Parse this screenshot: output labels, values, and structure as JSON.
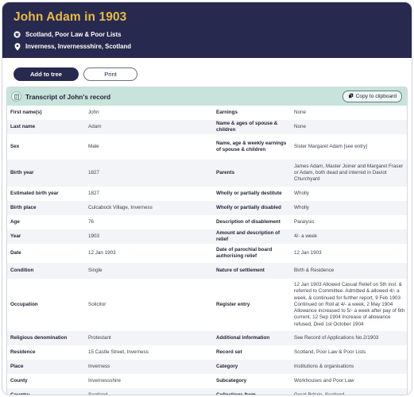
{
  "header": {
    "title": "John Adam in 1903",
    "collection": "Scotland, Poor Law & Poor Lists",
    "location": "Inverness, Invernessshire, Scotland",
    "collection_icon": "archive-icon",
    "location_icon": "location-pin-icon",
    "bg_color": "#27294e",
    "title_color": "#e9b949"
  },
  "actions": {
    "add_label": "Add to tree",
    "print_label": "Print"
  },
  "record": {
    "title": "Transcript of John's record",
    "copy_label": "Copy to clipboard",
    "head_color": "#c7e3dc",
    "rows": [
      {
        "l1": "First name(s)",
        "v1": "John",
        "l2": "Earnings",
        "v2": "None"
      },
      {
        "l1": "Last name",
        "v1": "Adam",
        "l2": "Name & ages of spouse & children",
        "v2": "None"
      },
      {
        "l1": "Sex",
        "v1": "Male",
        "l2": "Name, age & weekly earnings of spouse & children",
        "v2": "Sister Margaret Adam [see entry]"
      },
      {
        "l1": "Birth year",
        "v1": "1827",
        "l2": "Parents",
        "v2": "James Adam, Master Joiner and Margaret Fraser or Adam, both dead and interred in Daviot Churchyard"
      },
      {
        "l1": "Estimated birth year",
        "v1": "1827",
        "l2": "Wholly or partially destitute",
        "v2": "Wholly"
      },
      {
        "l1": "Birth place",
        "v1": "Culcabock Village, Inverness",
        "l2": "Wholly or partially disabled",
        "v2": "Wholly"
      },
      {
        "l1": "Age",
        "v1": "76",
        "l2": "Description of disablement",
        "v2": "Paralysis"
      },
      {
        "l1": "Year",
        "v1": "1903",
        "l2": "Amount and description of relief",
        "v2": "4/- a week"
      },
      {
        "l1": "Date",
        "v1": "12 Jan 1903",
        "l2": "Date of parochial board authorising relief",
        "v2": "12 Jan 1903"
      },
      {
        "l1": "Condition",
        "v1": "Single",
        "l2": "Nature of settlement",
        "v2": "Birth & Residence"
      },
      {
        "l1": "Occupation",
        "v1": "Solicitor",
        "l2": "Register entry",
        "v2": "12 Jan 1903 Allowed Casual Relief on 5th inst. & referred to Committee. Admitted & allowed 4/- a week, & continued for further report, 9 Feb 1903 Continued on Roll at 4/- a week, 2 May 1904 Allowance increased to 5/- a week after pay of 6th current, 12 Sep 1904 Increase of allowance refused, Died 1st October 1904"
      },
      {
        "l1": "Religious denomination",
        "v1": "Protestant",
        "l2": "Additional information",
        "v2": "See Record of Applications No.2/1903"
      },
      {
        "l1": "Residence",
        "v1": "15 Castle Street, Inverness",
        "l2": "Record set",
        "v2": "Scotland, Poor Law & Poor Lists"
      },
      {
        "l1": "Place",
        "v1": "Inverness",
        "l2": "Category",
        "v2": "Institutions & organisations"
      },
      {
        "l1": "County",
        "v1": "Invernessshire",
        "l2": "Subcategory",
        "v2": "Workhouses and Poor Law"
      },
      {
        "l1": "Country",
        "v1": "Scotland",
        "l2": "Collections from",
        "v2": "Great Britain, Scotland"
      }
    ]
  }
}
